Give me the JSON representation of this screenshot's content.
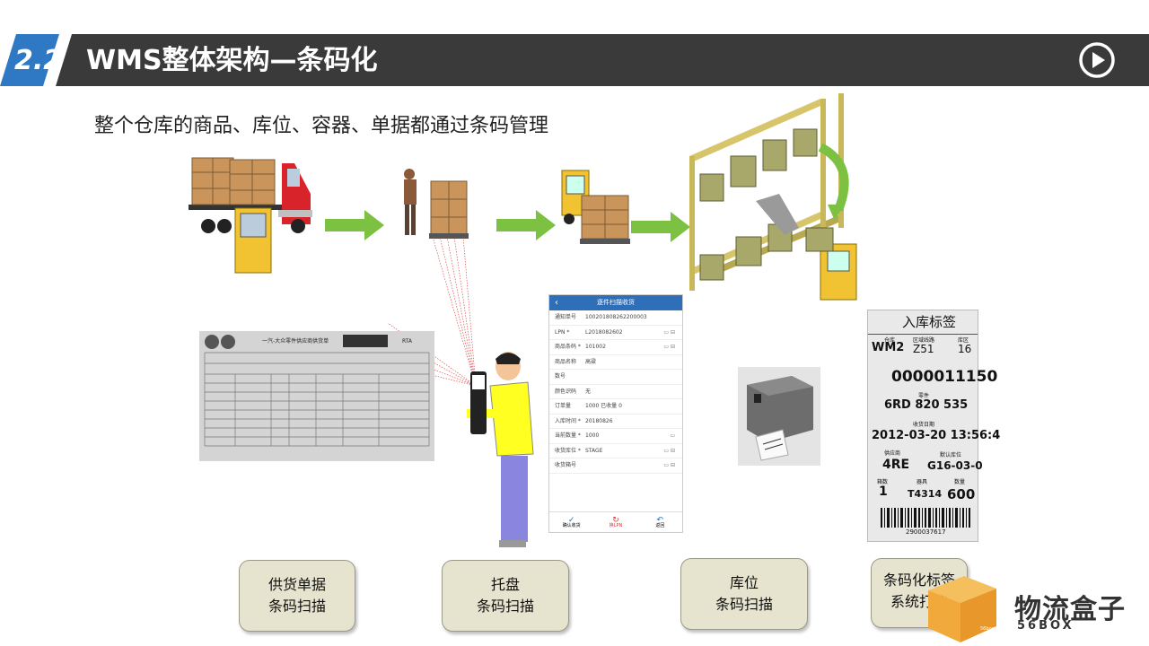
{
  "header": {
    "section_number": "2.2",
    "title": "WMS整体架构—条码化"
  },
  "subtitle": "整个仓库的商品、库位、容器、单据都通过条码管理",
  "labels": [
    {
      "line1": "供货单据",
      "line2": "条码扫描"
    },
    {
      "line1": "托盘",
      "line2": "条码扫描"
    },
    {
      "line1": "库位",
      "line2": "条码扫描"
    },
    {
      "line1": "条码化标签",
      "line2": "系统打印"
    }
  ],
  "phone": {
    "title": "逐件扫描收货",
    "rows": [
      {
        "label": "通知单号",
        "value": "100201808262200003",
        "icons": ""
      },
      {
        "label": "LPN *",
        "value": "L2018082602",
        "icons": "▭ ⊟"
      },
      {
        "label": "商品条码 *",
        "value": "101002",
        "icons": "▭ ⊟"
      },
      {
        "label": "商品名称",
        "value": "高粱",
        "icons": ""
      },
      {
        "label": "数号",
        "value": "",
        "icons": ""
      },
      {
        "label": "颜色识码",
        "value": "无",
        "icons": ""
      },
      {
        "label": "订单量",
        "value": "1000      已收量         0",
        "icons": ""
      },
      {
        "label": "入库时间 *",
        "value": "20180826",
        "icons": ""
      },
      {
        "label": "当前数量 *",
        "value": "1000",
        "icons": "▭"
      },
      {
        "label": "收货库位 *",
        "value": "STAGE",
        "icons": "▭ ⊟"
      },
      {
        "label": "收货箱号",
        "value": "",
        "icons": "▭ ⊟"
      }
    ],
    "footer": [
      "确认收货",
      "换LPN",
      "返回"
    ]
  },
  "tag": {
    "title": "入库标签",
    "warehouse_label": "仓库",
    "warehouse": "WM2",
    "route_label": "区域线路",
    "route": "Z51",
    "zone_label": "库区",
    "zone": "16",
    "code": "0000011150",
    "part_label": "零件",
    "part": "6RD 820 535",
    "date_label": "收货日期",
    "date": "2012-03-20 13:56:4",
    "supplier_label": "供应商",
    "supplier": "4RE",
    "location_label": "默认库位",
    "location": "G16-03-0",
    "boxes_label": "箱数",
    "boxes": "1",
    "container_label": "器具",
    "container": "T4314",
    "qty_label": "数量",
    "qty": "600",
    "barcode_text": "2900037617"
  },
  "document": {
    "title": "一汽-大众零件供应商供货单",
    "barcode_text": "RTA"
  },
  "logo": {
    "name": "物流盒子",
    "sub": "56BOX",
    "mark": "56box"
  },
  "colors": {
    "header_bg": "#3a3a3a",
    "badge_blue": "#2f78c4",
    "arrow_green": "#7dc142",
    "label_bg": "#e6e4cf",
    "logo_orange": "#f2a93b"
  }
}
